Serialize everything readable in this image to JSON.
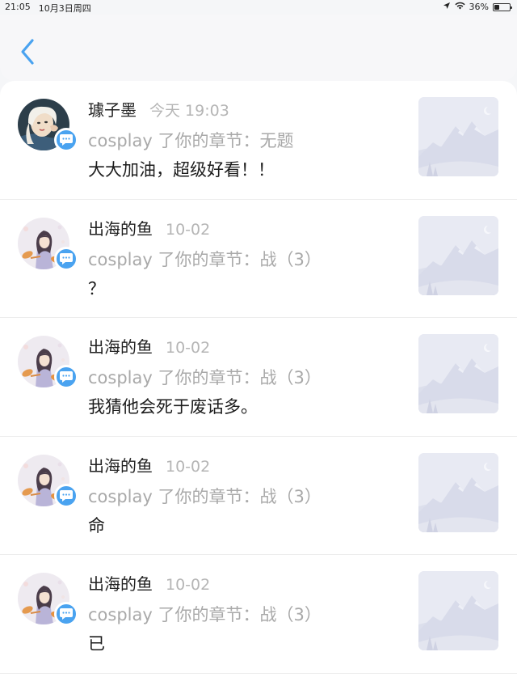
{
  "status_bar": {
    "time": "21:05",
    "date": "10月3日周四",
    "battery": "36%",
    "battery_level": 0.36
  },
  "header": {
    "back_icon": "chevron-left-icon",
    "accent_color": "#4aa3f0"
  },
  "messages": [
    {
      "username": "璩子墨",
      "time": "今天 19:03",
      "action": "cosplay 了你的章节：无题",
      "content": "大大加油，超级好看！！",
      "avatar": "photo-avatar"
    },
    {
      "username": "出海的鱼",
      "time": "10-02",
      "action": "cosplay 了你的章节：战（3）",
      "content": "？",
      "avatar": "illustrated-girl-avatar"
    },
    {
      "username": "出海的鱼",
      "time": "10-02",
      "action": "cosplay 了你的章节：战（3）",
      "content": "我猜他会死于废话多。",
      "avatar": "illustrated-girl-avatar"
    },
    {
      "username": "出海的鱼",
      "time": "10-02",
      "action": "cosplay 了你的章节：战（3）",
      "content": "命",
      "avatar": "illustrated-girl-avatar"
    },
    {
      "username": "出海的鱼",
      "time": "10-02",
      "action": "cosplay 了你的章节：战（3）",
      "content": "已",
      "avatar": "illustrated-girl-avatar"
    }
  ]
}
